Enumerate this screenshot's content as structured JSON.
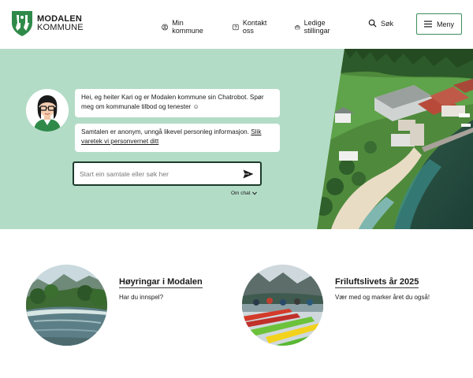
{
  "header": {
    "logo_line1": "MODALEN",
    "logo_line2": "KOMMUNE",
    "nav": [
      {
        "label": "Min kommune",
        "icon": "user-circle-icon"
      },
      {
        "label": "Kontakt oss",
        "icon": "help-square-icon"
      },
      {
        "label": "Ledige stillingar",
        "icon": "briefcase-icon"
      },
      {
        "label": "Søk",
        "icon": "search-icon"
      }
    ],
    "menu_label": "Meny"
  },
  "chat": {
    "message_1": "Hei, eg heiter Kari og er Modalen kommune sin Chatrobot. Spør meg om kommunale tilbod og tenester ☺",
    "message_2_text": "Samtalen er anonym, unngå likevel personleg informasjon. ",
    "message_2_link": "Slik varetek vi personvernet ditt",
    "input_placeholder": "Start ein samtale eller søk her",
    "about_label": "Om chat"
  },
  "cards": [
    {
      "title": "Høyringar i Modalen",
      "subtitle": "Har du innspel?"
    },
    {
      "title": "Friluftslivets år 2025",
      "subtitle": "Vær med og marker året du også!"
    }
  ],
  "colors": {
    "brand_green": "#2f8a4a",
    "hero_bg": "#b3dcc7",
    "input_border": "#1d3b2b",
    "menu_border": "#3d8f5c"
  }
}
